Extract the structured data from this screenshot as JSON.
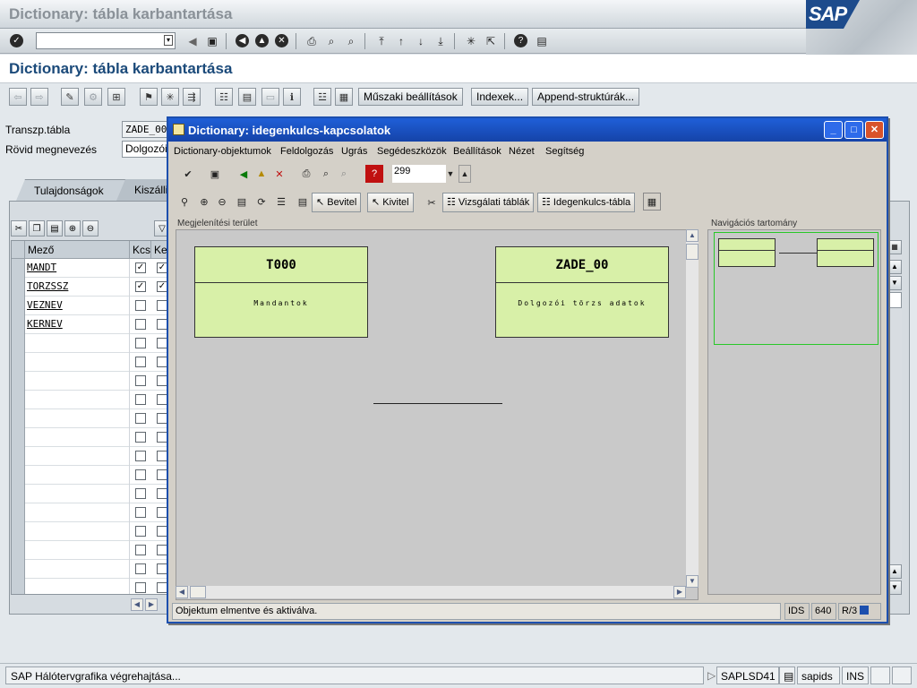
{
  "window": {
    "title": "Dictionary: tábla karbantartása",
    "logo": "SAP"
  },
  "cmdbar": {
    "command_value": ""
  },
  "app": {
    "title": "Dictionary: tábla karbantartása"
  },
  "apptoolbar": {
    "buttons": [
      "Műszaki beállítások",
      "Indexek...",
      "Append-struktúrák..."
    ]
  },
  "form": {
    "transp_label": "Transzp.tábla",
    "transp_value": "ZADE_00",
    "short_label": "Rövid megnevezés",
    "short_value": "Dolgozói"
  },
  "tabs": [
    "Tulajdonságok",
    "Kiszálli"
  ],
  "grid": {
    "col_field": "Mező",
    "col_key": "Kcs",
    "col_init": "Ke",
    "rows": [
      {
        "name": "MANDT",
        "key": true,
        "init": true
      },
      {
        "name": "TORZSSZ",
        "key": true,
        "init": true
      },
      {
        "name": "VEZNEV",
        "key": false,
        "init": false
      },
      {
        "name": "KERNEV",
        "key": false,
        "init": false
      }
    ],
    "empty_rows": 14
  },
  "statusbar": {
    "message": "SAP Hálótervgrafika végrehajtása...",
    "program": "SAPLSD41",
    "server": "sapids",
    "mode": "INS"
  },
  "dialog": {
    "title": "Dictionary: idegenkulcs-kapcsolatok",
    "menu": [
      "Dictionary-objektumok",
      "Feldolgozás",
      "Ugrás",
      "Segédeszközök",
      "Beállítások",
      "Nézet",
      "Segítség"
    ],
    "zoom_value": "299",
    "buttons": {
      "import": "Bevitel",
      "export": "Kivitel",
      "check_tables": "Vizsgálati táblák",
      "fk_table": "Idegenkulcs-tábla"
    },
    "display_label": "Megjelenítési terület",
    "nav_label": "Navigációs tartomány",
    "nodes": [
      {
        "name": "T000",
        "desc": "Mandantok"
      },
      {
        "name": "ZADE_00",
        "desc": "Dolgozói törzs adatok"
      }
    ],
    "status": {
      "message": "Objektum elmentve és aktiválva.",
      "system": "IDS",
      "client": "640",
      "release": "R/3"
    }
  },
  "colors": {
    "accent": "#1b4a7a",
    "dialog_title": "#1f5fd8",
    "node_fill": "#d8f0a8",
    "nav_frame": "#28c828"
  },
  "icons": [
    "check-icon",
    "save-icon",
    "back-icon",
    "exit-icon",
    "cancel-icon",
    "print-icon",
    "find-icon",
    "help-icon",
    "settings-icon"
  ]
}
